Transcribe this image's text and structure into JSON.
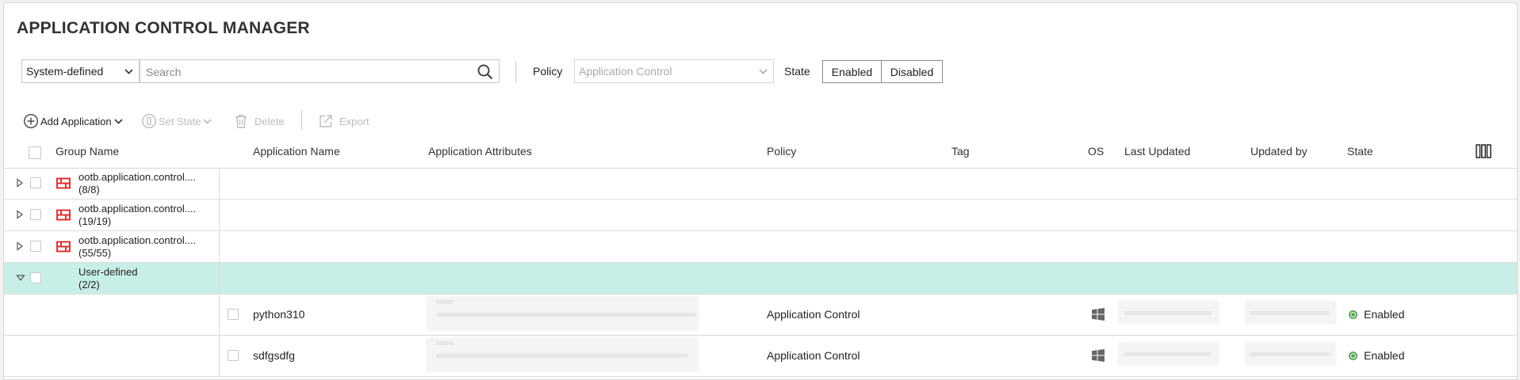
{
  "title": "APPLICATION CONTROL MANAGER",
  "filters": {
    "source_select": "System-defined",
    "search_placeholder": "Search",
    "policy_label": "Policy",
    "policy_select": "Application Control",
    "state_label": "State",
    "state_enabled": "Enabled",
    "state_disabled": "Disabled"
  },
  "toolbar": {
    "add_application": "Add Application",
    "set_state": "Set State",
    "delete": "Delete",
    "export": "Export"
  },
  "columns": {
    "group_name": "Group Name",
    "application_name": "Application Name",
    "application_attributes": "Application Attributes",
    "policy": "Policy",
    "tag": "Tag",
    "os": "OS",
    "last_updated": "Last Updated",
    "updated_by": "Updated by",
    "state": "State"
  },
  "groups": [
    {
      "name": "ootb.application.control....",
      "count": "(8/8)"
    },
    {
      "name": "ootb.application.control....",
      "count": "(19/19)"
    },
    {
      "name": "ootb.application.control....",
      "count": "(55/55)"
    },
    {
      "name": "User-defined",
      "count": "(2/2)"
    }
  ],
  "applications": [
    {
      "name": "python310",
      "policy": "Application Control",
      "os": "windows-icon",
      "state": "Enabled"
    },
    {
      "name": "sdfgsdfg",
      "policy": "Application Control",
      "os": "windows-icon",
      "state": "Enabled"
    }
  ],
  "colors": {
    "selected_row": "#c8efe7",
    "enabled_state": "#5aa65a",
    "group_icon": "#e02020"
  }
}
